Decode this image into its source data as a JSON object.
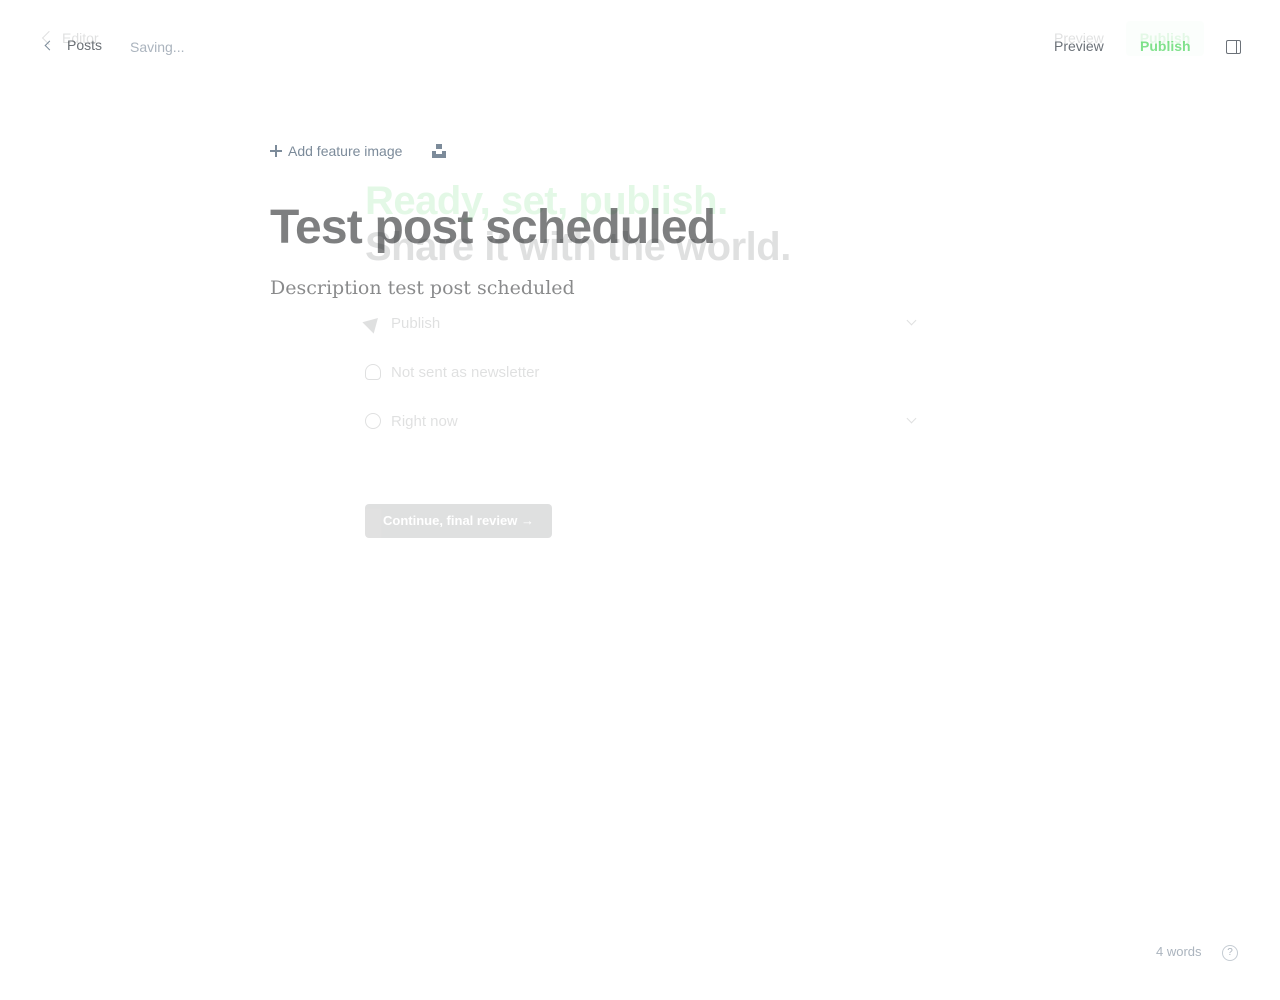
{
  "overlay": {
    "back_label": "Editor",
    "preview_label": "Preview",
    "publish_label": "Publish",
    "headline_line1": "Ready, set, publish.",
    "headline_line2": "Share it with the world.",
    "options": [
      {
        "icon": "paper-plane-icon",
        "label": "Publish"
      },
      {
        "icon": "user-icon",
        "label": "Not sent as newsletter"
      },
      {
        "icon": "clock-icon",
        "label": "Right now"
      }
    ],
    "continue_label": "Continue, final review →"
  },
  "header": {
    "back_label": "Posts",
    "status": "Saving...",
    "preview_label": "Preview",
    "publish_label": "Publish"
  },
  "editor": {
    "add_feature_image_label": "Add feature image",
    "title": "Test post scheduled",
    "excerpt": "Description test post scheduled"
  },
  "footer": {
    "word_count": "4 words",
    "help_glyph": "?"
  },
  "colors": {
    "accent_green": "#30cf43",
    "text_dark": "#15171a",
    "text_muted": "#7c8b9a"
  }
}
